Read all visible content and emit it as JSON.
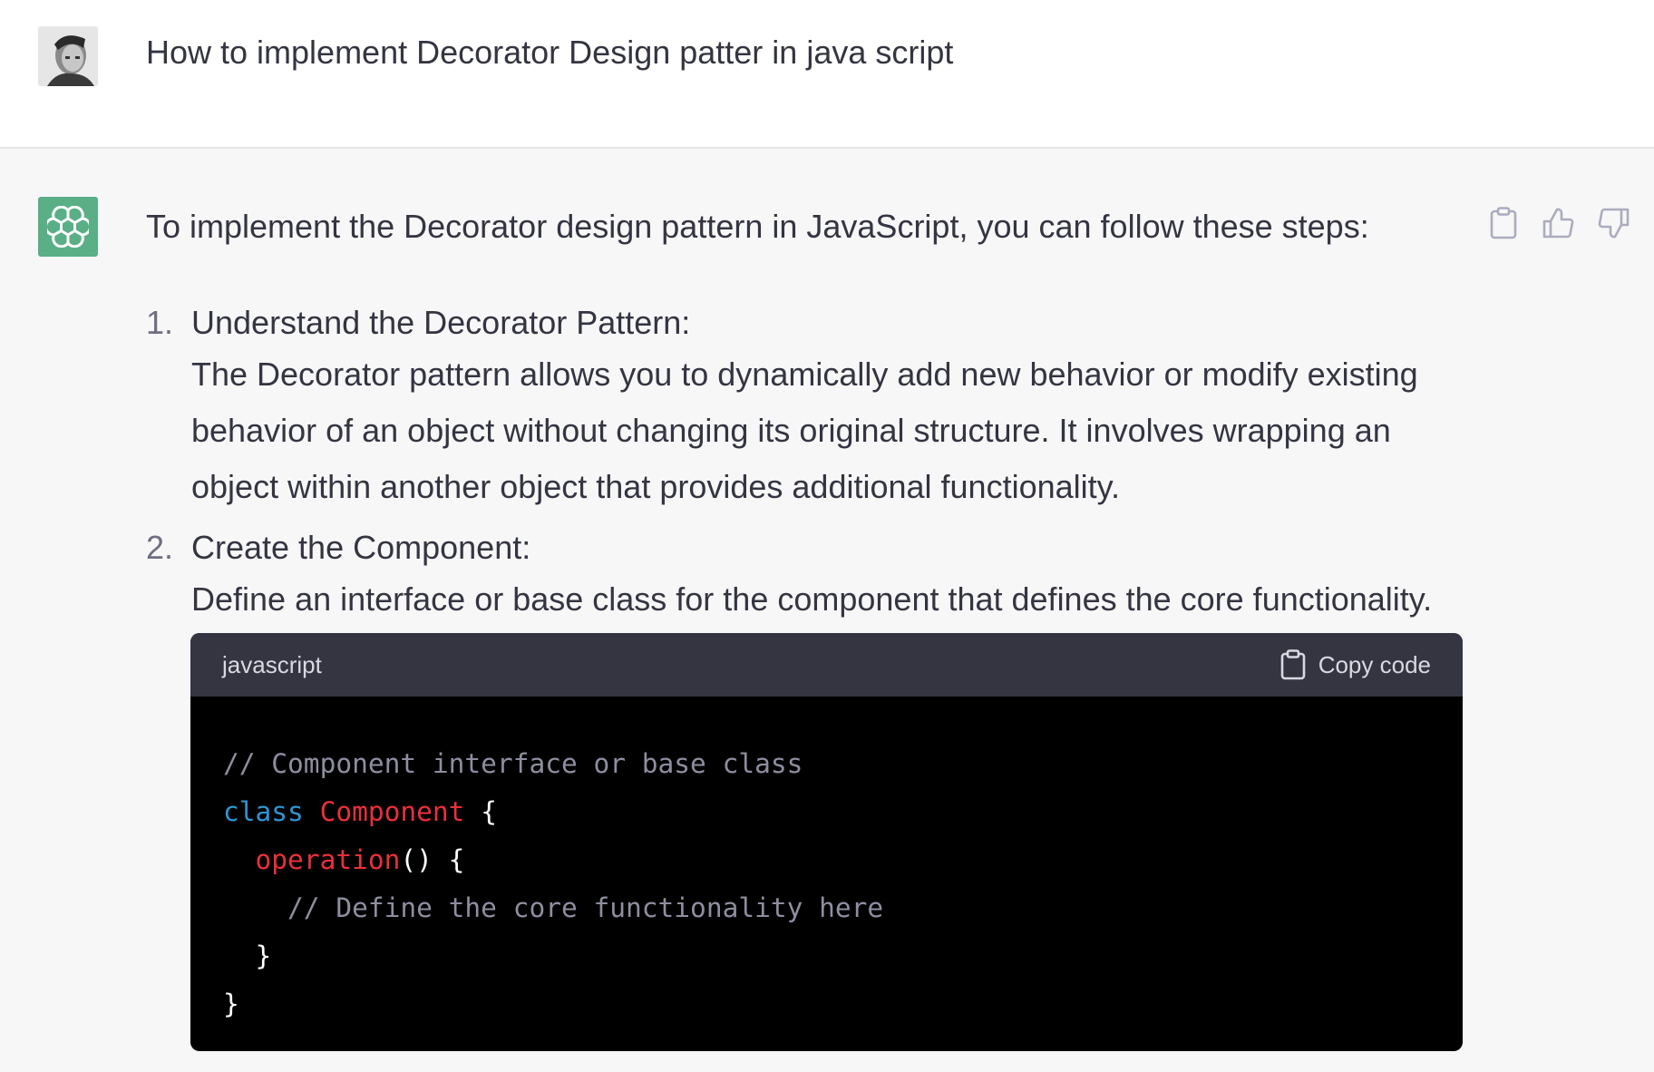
{
  "user": {
    "message": "How to implement Decorator Design patter in java script"
  },
  "assistant": {
    "intro": "To implement the Decorator design pattern in JavaScript, you can follow these steps:",
    "steps": [
      {
        "number": "1.",
        "title": "Understand the Decorator Pattern:",
        "body_lines": [
          "The Decorator pattern allows you to dynamically add new behavior or modify existing",
          "behavior of an object without changing its original structure. It involves wrapping an",
          "object within another object that provides additional functionality."
        ]
      },
      {
        "number": "2.",
        "title": "Create the Component:",
        "body_lines": [
          "Define an interface or base class for the component that defines the core functionality."
        ]
      }
    ],
    "code": {
      "language": "javascript",
      "copy_label": "Copy code",
      "lines": {
        "l1_comment": "// Component interface or base class",
        "l2_keyword": "class",
        "l2_name": "Component",
        "l2_brace": "{",
        "l3_fn": "operation",
        "l3_rest": "() {",
        "l4_comment": "// Define the core functionality here",
        "l5_brace": "}",
        "l6_brace": "}"
      }
    },
    "actions": [
      "copy-icon",
      "thumbs-up-icon",
      "thumbs-down-icon"
    ]
  },
  "colors": {
    "assistant_avatar": "#5aaf86",
    "code_header": "#343541",
    "code_bg": "#000000",
    "keyword": "#2e95d3",
    "class_name": "#e9303b",
    "comment": "#8e8ea0"
  }
}
